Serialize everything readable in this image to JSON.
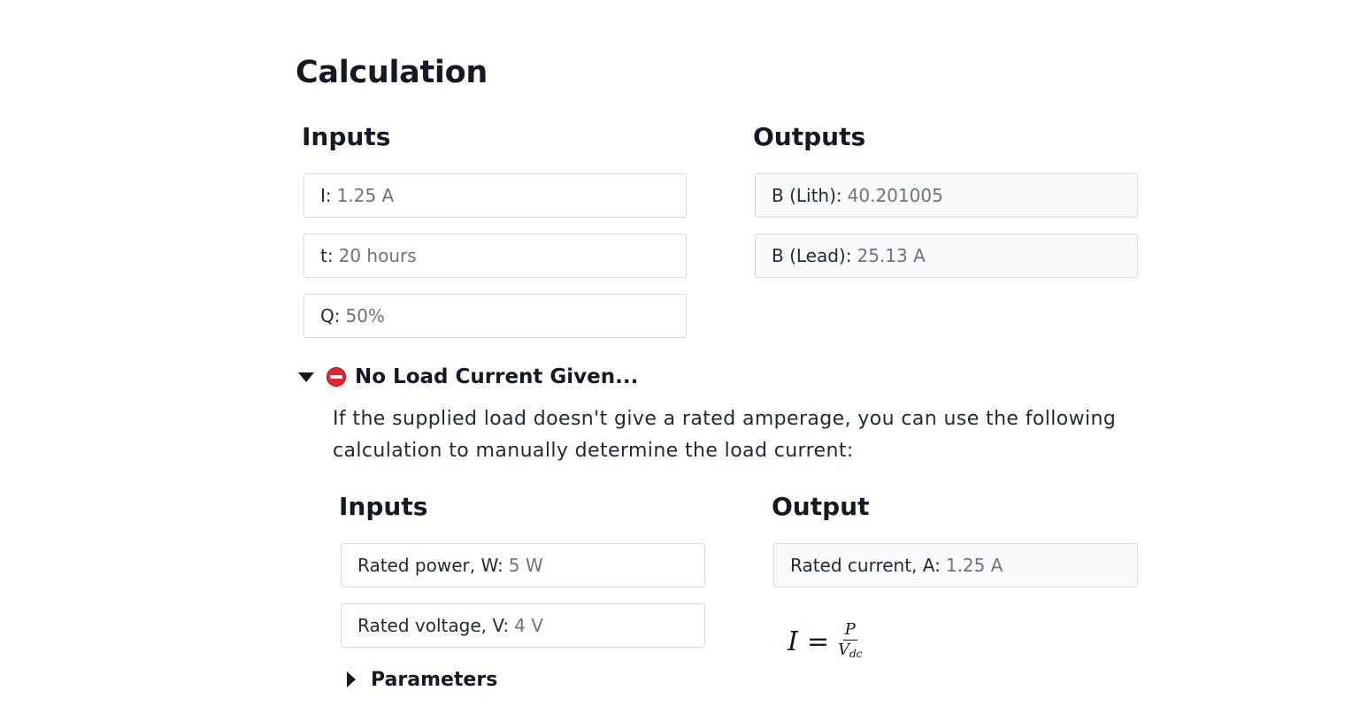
{
  "calculation": {
    "title": "Calculation",
    "inputs_heading": "Inputs",
    "outputs_heading": "Outputs",
    "inputs": [
      {
        "label": "I:",
        "value": "1.25 A"
      },
      {
        "label": "t:",
        "value": "20 hours"
      },
      {
        "label": "Q:",
        "value": "50%"
      }
    ],
    "outputs": [
      {
        "label": "B (Lith):",
        "value": "40.201005"
      },
      {
        "label": "B (Lead):",
        "value": "25.13 A"
      }
    ]
  },
  "no_load": {
    "icon": "no-entry-icon",
    "summary": "No Load Current Given...",
    "description": "If the supplied load doesn't give a rated amperage, you can use the following calculation to manually determine the load current:",
    "inputs_heading": "Inputs",
    "output_heading": "Output",
    "inputs": [
      {
        "label": "Rated power, W:",
        "value": "5 W"
      },
      {
        "label": "Rated voltage, V:",
        "value": "4 V"
      }
    ],
    "output": {
      "label": "Rated current, A:",
      "value": "1.25 A"
    },
    "formula": {
      "lhs": "I",
      "eq": "=",
      "numerator": "P",
      "denominator": "V",
      "denominator_sub": "dc"
    },
    "parameters_label": "Parameters"
  }
}
